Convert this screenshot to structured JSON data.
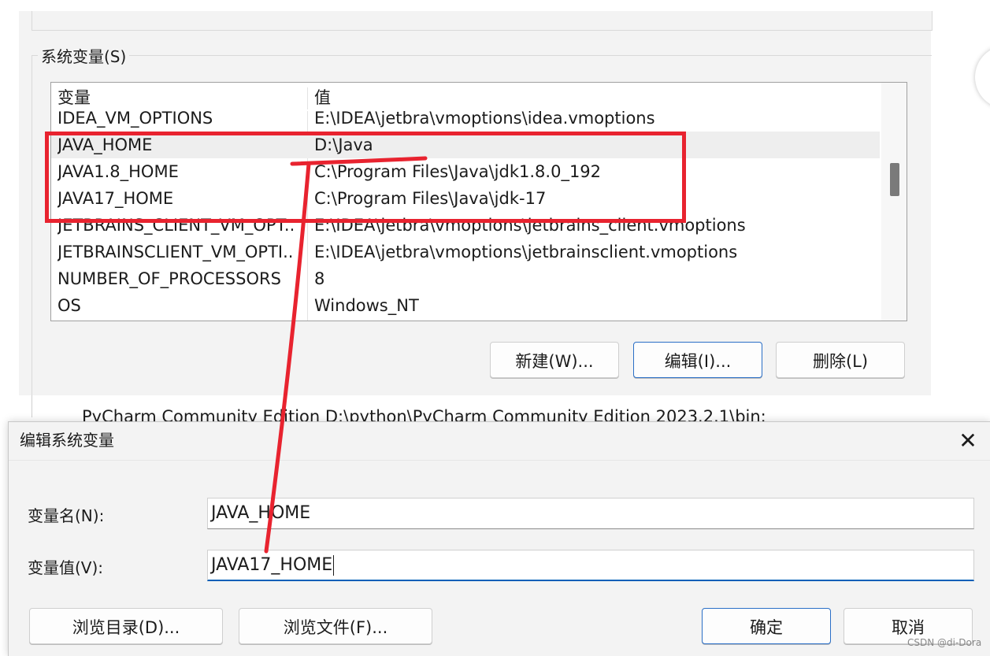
{
  "system_vars": {
    "group_title": "系统变量(S)",
    "columns": {
      "name": "变量",
      "value": "值"
    },
    "rows": [
      {
        "name": "IDEA_VM_OPTIONS",
        "value": "E:\\IDEA\\jetbra\\vmoptions\\idea.vmoptions"
      },
      {
        "name": "JAVA_HOME",
        "value": "D:\\Java"
      },
      {
        "name": "JAVA1.8_HOME",
        "value": "C:\\Program Files\\Java\\jdk1.8.0_192"
      },
      {
        "name": "JAVA17_HOME",
        "value": "C:\\Program Files\\Java\\jdk-17"
      },
      {
        "name": "JETBRAINS_CLIENT_VM_OPT...",
        "value": "E:\\IDEA\\jetbra\\vmoptions\\jetbrains_client.vmoptions"
      },
      {
        "name": "JETBRAINSCLIENT_VM_OPTI...",
        "value": "E:\\IDEA\\jetbra\\vmoptions\\jetbrainsclient.vmoptions"
      },
      {
        "name": "NUMBER_OF_PROCESSORS",
        "value": "8"
      },
      {
        "name": "OS",
        "value": "Windows_NT"
      }
    ],
    "buttons": {
      "new": "新建(W)...",
      "edit": "编辑(I)...",
      "delete": "删除(L)"
    }
  },
  "peek_line": "PyCharm Community Edition    D:\\python\\PyCharm Community Edition 2023.2.1\\bin;",
  "dialog": {
    "title": "编辑系统变量",
    "name_label": "变量名(N):",
    "name_value": "JAVA_HOME",
    "value_label": "变量值(V):",
    "value_value": "JAVA17_HOME",
    "buttons": {
      "browse_dir": "浏览目录(D)...",
      "browse_file": "浏览文件(F)...",
      "ok": "确定",
      "cancel": "取消"
    }
  },
  "watermark": "CSDN @di-Dora",
  "colors": {
    "annotation": "#e8232f",
    "focus": "#005fb8",
    "selected_row": "#eeeeee"
  }
}
